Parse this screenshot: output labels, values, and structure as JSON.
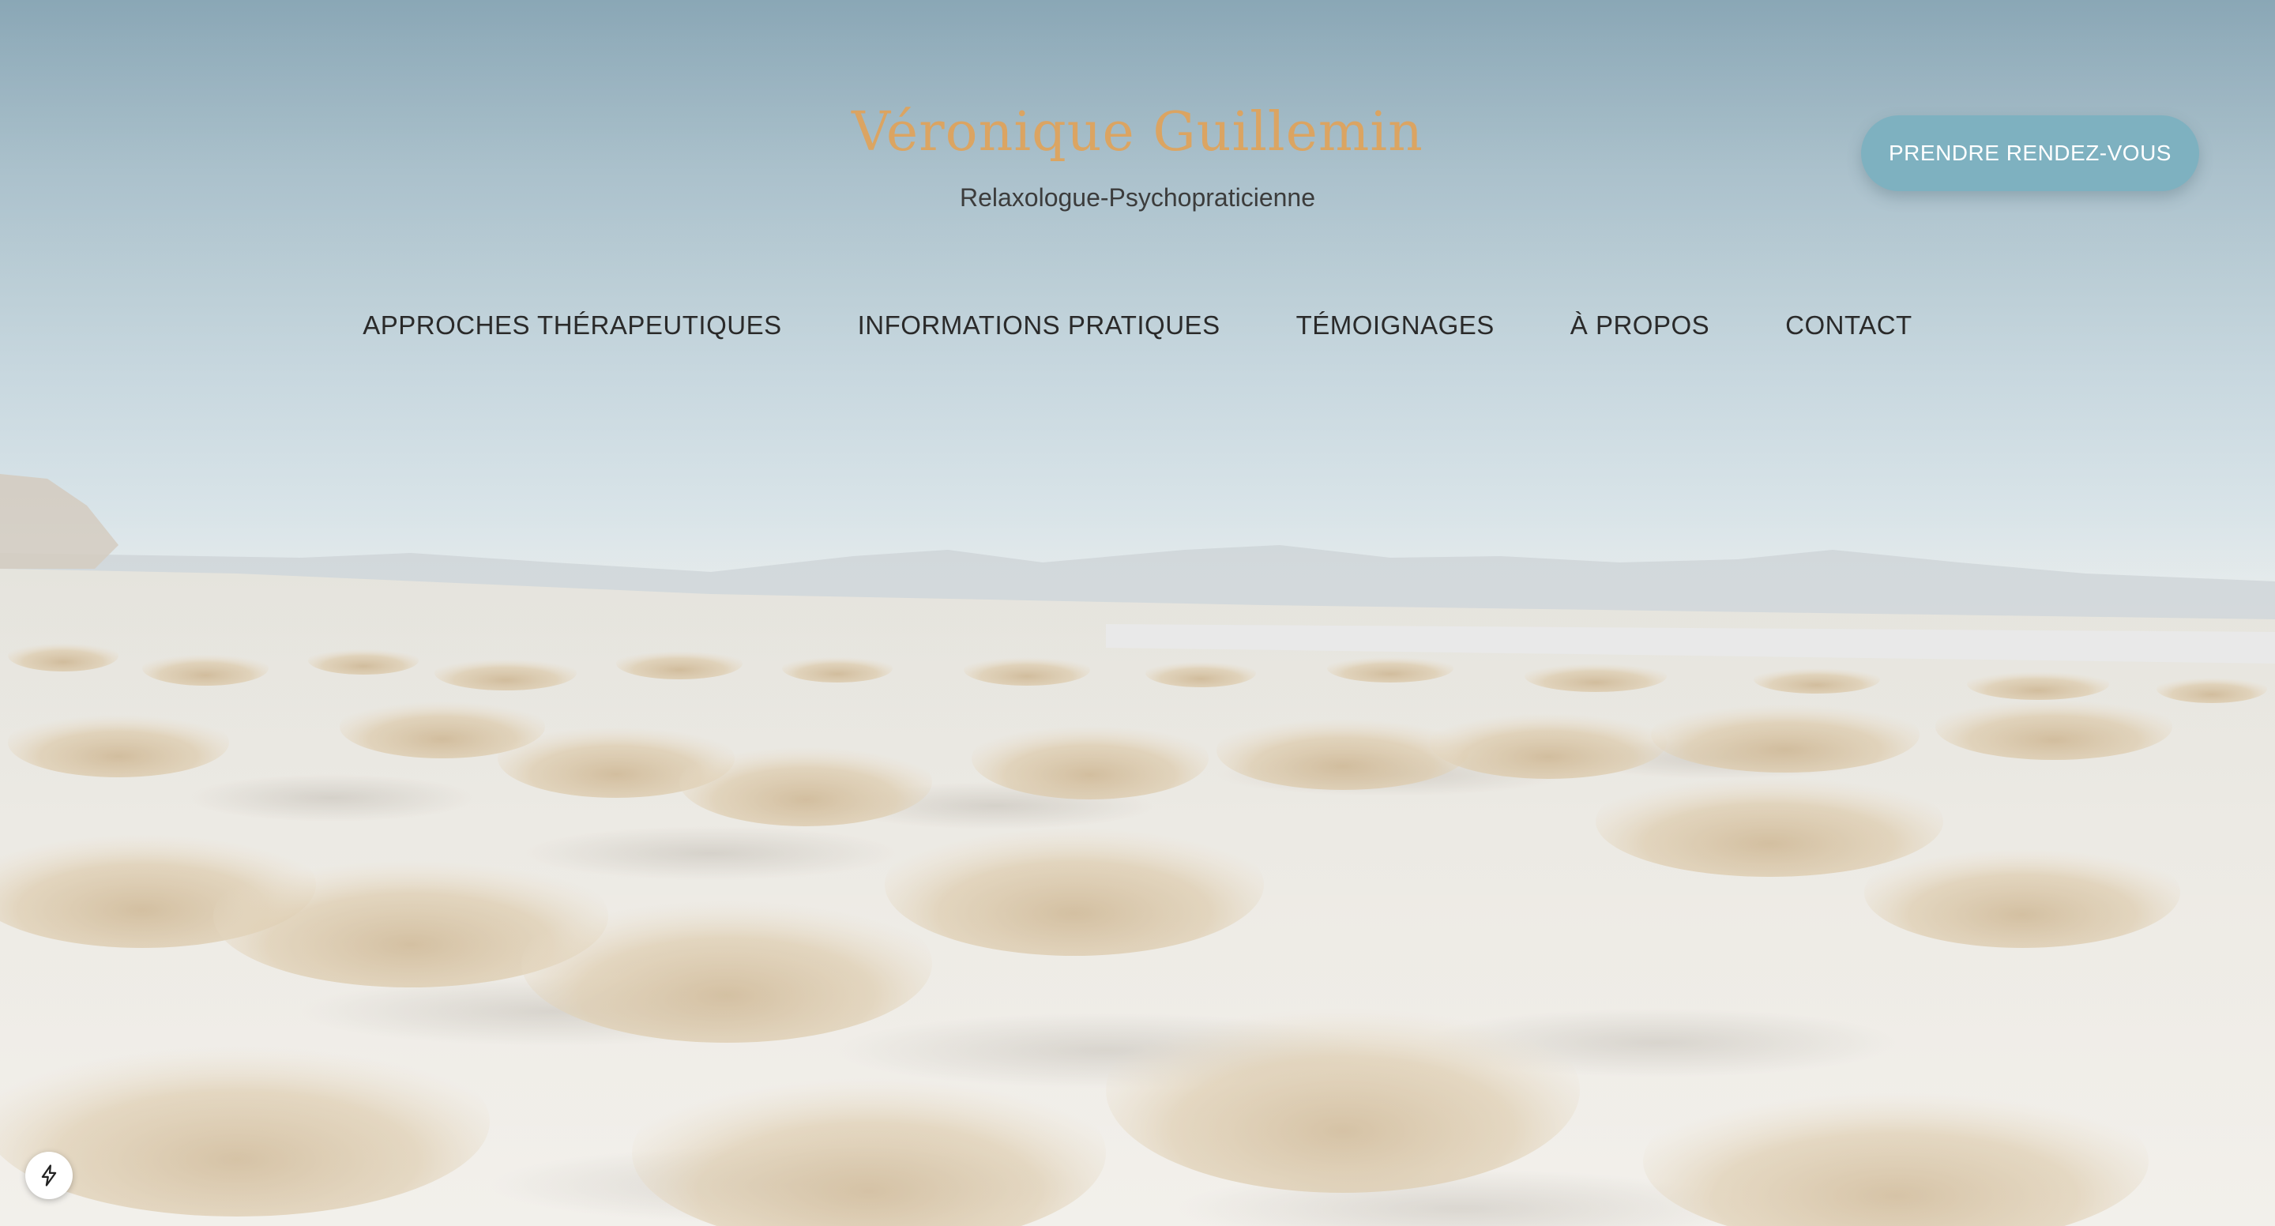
{
  "brand": {
    "name": "Véronique Guillemin",
    "tagline": "Relaxologue-Psychopraticienne"
  },
  "cta": {
    "label": "PRENDRE RENDEZ-VOUS"
  },
  "nav": {
    "items": [
      {
        "label": "APPROCHES THÉRAPEUTIQUES"
      },
      {
        "label": "INFORMATIONS PRATIQUES"
      },
      {
        "label": "TÉMOIGNAGES"
      },
      {
        "label": "À PROPOS"
      },
      {
        "label": "CONTACT"
      }
    ]
  },
  "hero": {
    "image": "desert-landscape-dry-grass-background"
  },
  "widget": {
    "icon": "lightning-bolt-icon"
  },
  "colors": {
    "brand_name": "#e0a35a",
    "cta_background": "#7eb1c0",
    "cta_text": "#ffffff",
    "nav_text": "#2a2a2a"
  }
}
